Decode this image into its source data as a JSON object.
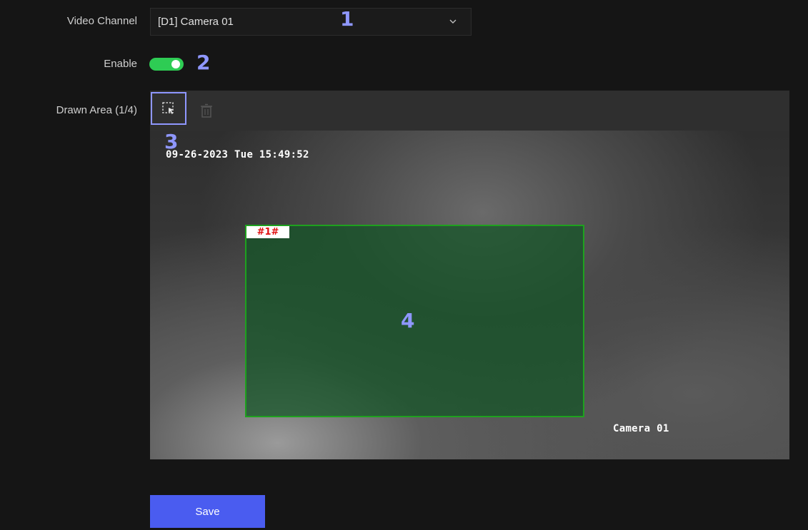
{
  "form": {
    "video_channel_label": "Video Channel",
    "video_channel_value": "[D1] Camera 01",
    "enable_label": "Enable",
    "enable_on": true,
    "drawn_area_label": "Drawn Area (1/4)"
  },
  "toolbar": {
    "draw_icon": "draw-area-icon",
    "delete_icon": "trash-icon"
  },
  "video": {
    "timestamp": "09-26-2023 Tue 15:49:52",
    "camera_name": "Camera 01",
    "area_tag": "#1#"
  },
  "callouts": [
    "1",
    "2",
    "3",
    "4"
  ],
  "actions": {
    "save_label": "Save"
  },
  "colors": {
    "accent": "#4a5cf0",
    "toggle_on": "#2ecc54",
    "callout": "#8f97ff",
    "area_border": "#1ea11e",
    "area_tag_text": "#e01010"
  }
}
